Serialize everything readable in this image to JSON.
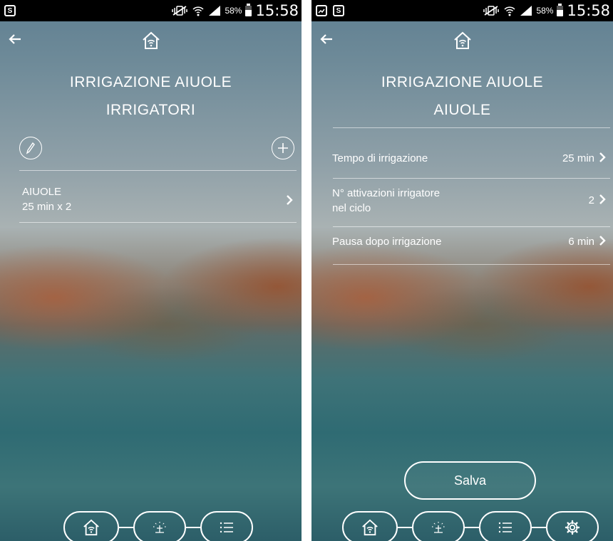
{
  "status_bar": {
    "battery": "58%",
    "time": "15:58",
    "icons": [
      "shield-app-icon",
      "image-icon",
      "vibrate-mute-icon",
      "wifi-icon",
      "signal-icon",
      "battery-icon"
    ]
  },
  "left_screen": {
    "title_line1": "IRRIGAZIONE AIUOLE",
    "title_line2": "IRRIGATORI",
    "items": [
      {
        "name": "AIUOLE",
        "detail": "25 min x 2"
      }
    ],
    "bottom_nav": [
      "home-icon",
      "sprinkler-icon",
      "list-icon"
    ]
  },
  "right_screen": {
    "title_line1": "IRRIGAZIONE AIUOLE",
    "title_line2": "AIUOLE",
    "settings": [
      {
        "label": "Tempo di irrigazione",
        "value": "25 min"
      },
      {
        "label_line1": "N° attivazioni irrigatore",
        "label_line2": "nel ciclo",
        "value": "2"
      },
      {
        "label": "Pausa dopo irrigazione",
        "value": "6 min"
      }
    ],
    "save_label": "Salva",
    "bottom_nav": [
      "home-icon",
      "sprinkler-icon",
      "list-icon",
      "gear-icon"
    ]
  },
  "colors": {
    "status_bar": "#000000",
    "text": "#ffffff"
  }
}
